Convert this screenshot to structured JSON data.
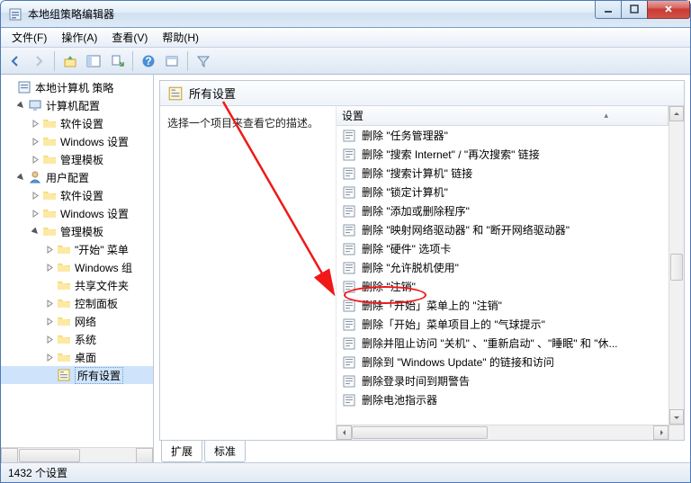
{
  "window": {
    "title": "本地组策略编辑器"
  },
  "menu": {
    "file": "文件(F)",
    "action": "操作(A)",
    "view": "查看(V)",
    "help": "帮助(H)"
  },
  "tree": {
    "root": "本地计算机 策略",
    "computer": "计算机配置",
    "software1": "软件设置",
    "windows1": "Windows 设置",
    "admin1": "管理模板",
    "user": "用户配置",
    "software2": "软件设置",
    "windows2": "Windows 设置",
    "admin2": "管理模板",
    "startmenu": "\"开始\" 菜单",
    "wincomp": "Windows 组",
    "shared": "共享文件夹",
    "control": "控制面板",
    "network": "网络",
    "system": "系统",
    "desktop": "桌面",
    "allsettings": "所有设置"
  },
  "right": {
    "title": "所有设置",
    "desc": "选择一个项目来查看它的描述。",
    "col_setting": "设置",
    "items": [
      "删除 \"任务管理器\"",
      "删除 \"搜索 Internet\" / \"再次搜索\" 链接",
      "删除 \"搜索计算机\" 链接",
      "删除 \"锁定计算机\"",
      "删除 \"添加或删除程序\"",
      "删除 \"映射网络驱动器\" 和 \"断开网络驱动器\"",
      "删除 \"硬件\" 选项卡",
      "删除 \"允许脱机使用\"",
      "删除 \"注销\"",
      "删除「开始」菜单上的 \"注销\"",
      "删除「开始」菜单项目上的 \"气球提示\"",
      "删除并阻止访问 \"关机\" 、\"重新启动\" 、\"睡眠\" 和 \"休...",
      "删除到 \"Windows Update\" 的链接和访问",
      "删除登录时间到期警告",
      "删除电池指示器"
    ]
  },
  "tabs": {
    "extended": "扩展",
    "standard": "标准"
  },
  "status": {
    "count": "1432 个设置"
  }
}
